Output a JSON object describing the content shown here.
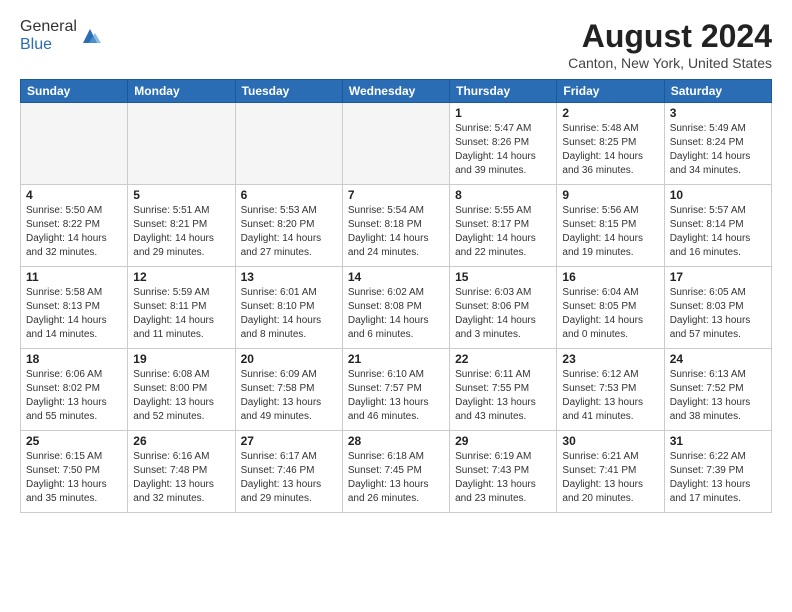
{
  "header": {
    "logo_general": "General",
    "logo_blue": "Blue",
    "month_year": "August 2024",
    "location": "Canton, New York, United States"
  },
  "weekdays": [
    "Sunday",
    "Monday",
    "Tuesday",
    "Wednesday",
    "Thursday",
    "Friday",
    "Saturday"
  ],
  "weeks": [
    [
      {
        "day": "",
        "info": "",
        "empty": true
      },
      {
        "day": "",
        "info": "",
        "empty": true
      },
      {
        "day": "",
        "info": "",
        "empty": true
      },
      {
        "day": "",
        "info": "",
        "empty": true
      },
      {
        "day": "1",
        "info": "Sunrise: 5:47 AM\nSunset: 8:26 PM\nDaylight: 14 hours and 39 minutes."
      },
      {
        "day": "2",
        "info": "Sunrise: 5:48 AM\nSunset: 8:25 PM\nDaylight: 14 hours and 36 minutes."
      },
      {
        "day": "3",
        "info": "Sunrise: 5:49 AM\nSunset: 8:24 PM\nDaylight: 14 hours and 34 minutes."
      }
    ],
    [
      {
        "day": "4",
        "info": "Sunrise: 5:50 AM\nSunset: 8:22 PM\nDaylight: 14 hours and 32 minutes."
      },
      {
        "day": "5",
        "info": "Sunrise: 5:51 AM\nSunset: 8:21 PM\nDaylight: 14 hours and 29 minutes."
      },
      {
        "day": "6",
        "info": "Sunrise: 5:53 AM\nSunset: 8:20 PM\nDaylight: 14 hours and 27 minutes."
      },
      {
        "day": "7",
        "info": "Sunrise: 5:54 AM\nSunset: 8:18 PM\nDaylight: 14 hours and 24 minutes."
      },
      {
        "day": "8",
        "info": "Sunrise: 5:55 AM\nSunset: 8:17 PM\nDaylight: 14 hours and 22 minutes."
      },
      {
        "day": "9",
        "info": "Sunrise: 5:56 AM\nSunset: 8:15 PM\nDaylight: 14 hours and 19 minutes."
      },
      {
        "day": "10",
        "info": "Sunrise: 5:57 AM\nSunset: 8:14 PM\nDaylight: 14 hours and 16 minutes."
      }
    ],
    [
      {
        "day": "11",
        "info": "Sunrise: 5:58 AM\nSunset: 8:13 PM\nDaylight: 14 hours and 14 minutes."
      },
      {
        "day": "12",
        "info": "Sunrise: 5:59 AM\nSunset: 8:11 PM\nDaylight: 14 hours and 11 minutes."
      },
      {
        "day": "13",
        "info": "Sunrise: 6:01 AM\nSunset: 8:10 PM\nDaylight: 14 hours and 8 minutes."
      },
      {
        "day": "14",
        "info": "Sunrise: 6:02 AM\nSunset: 8:08 PM\nDaylight: 14 hours and 6 minutes."
      },
      {
        "day": "15",
        "info": "Sunrise: 6:03 AM\nSunset: 8:06 PM\nDaylight: 14 hours and 3 minutes."
      },
      {
        "day": "16",
        "info": "Sunrise: 6:04 AM\nSunset: 8:05 PM\nDaylight: 14 hours and 0 minutes."
      },
      {
        "day": "17",
        "info": "Sunrise: 6:05 AM\nSunset: 8:03 PM\nDaylight: 13 hours and 57 minutes."
      }
    ],
    [
      {
        "day": "18",
        "info": "Sunrise: 6:06 AM\nSunset: 8:02 PM\nDaylight: 13 hours and 55 minutes."
      },
      {
        "day": "19",
        "info": "Sunrise: 6:08 AM\nSunset: 8:00 PM\nDaylight: 13 hours and 52 minutes."
      },
      {
        "day": "20",
        "info": "Sunrise: 6:09 AM\nSunset: 7:58 PM\nDaylight: 13 hours and 49 minutes."
      },
      {
        "day": "21",
        "info": "Sunrise: 6:10 AM\nSunset: 7:57 PM\nDaylight: 13 hours and 46 minutes."
      },
      {
        "day": "22",
        "info": "Sunrise: 6:11 AM\nSunset: 7:55 PM\nDaylight: 13 hours and 43 minutes."
      },
      {
        "day": "23",
        "info": "Sunrise: 6:12 AM\nSunset: 7:53 PM\nDaylight: 13 hours and 41 minutes."
      },
      {
        "day": "24",
        "info": "Sunrise: 6:13 AM\nSunset: 7:52 PM\nDaylight: 13 hours and 38 minutes."
      }
    ],
    [
      {
        "day": "25",
        "info": "Sunrise: 6:15 AM\nSunset: 7:50 PM\nDaylight: 13 hours and 35 minutes."
      },
      {
        "day": "26",
        "info": "Sunrise: 6:16 AM\nSunset: 7:48 PM\nDaylight: 13 hours and 32 minutes."
      },
      {
        "day": "27",
        "info": "Sunrise: 6:17 AM\nSunset: 7:46 PM\nDaylight: 13 hours and 29 minutes."
      },
      {
        "day": "28",
        "info": "Sunrise: 6:18 AM\nSunset: 7:45 PM\nDaylight: 13 hours and 26 minutes."
      },
      {
        "day": "29",
        "info": "Sunrise: 6:19 AM\nSunset: 7:43 PM\nDaylight: 13 hours and 23 minutes."
      },
      {
        "day": "30",
        "info": "Sunrise: 6:21 AM\nSunset: 7:41 PM\nDaylight: 13 hours and 20 minutes."
      },
      {
        "day": "31",
        "info": "Sunrise: 6:22 AM\nSunset: 7:39 PM\nDaylight: 13 hours and 17 minutes."
      }
    ]
  ]
}
